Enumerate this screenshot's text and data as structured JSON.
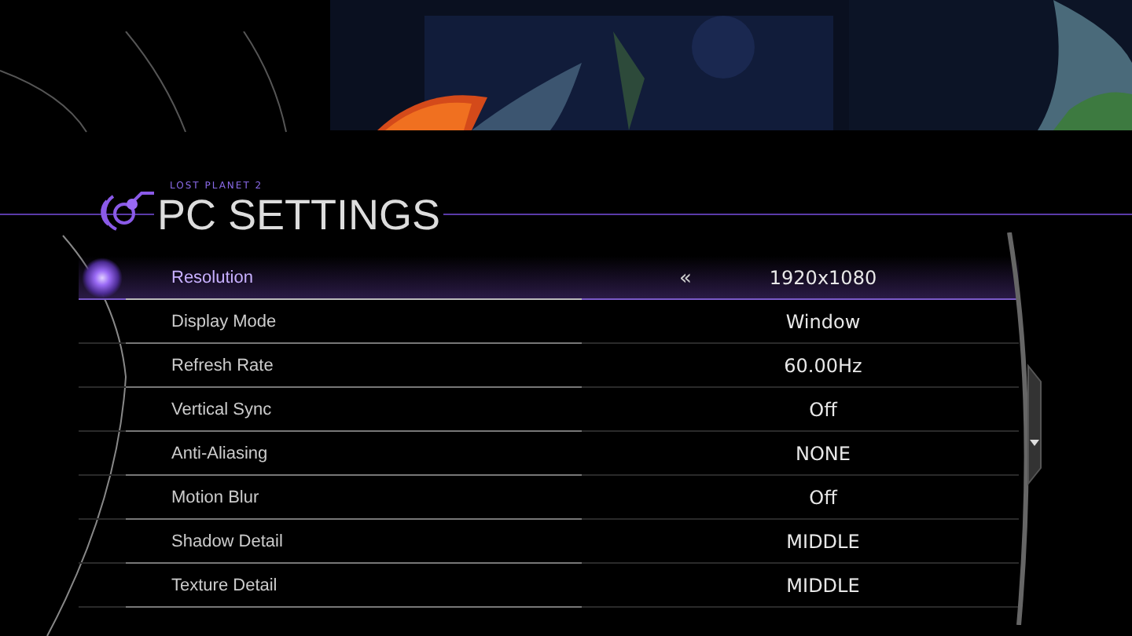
{
  "header": {
    "game": "LOST PLANET 2",
    "title": "PC SETTINGS"
  },
  "settings": [
    {
      "label": "Resolution",
      "value": "1920x1080",
      "selected": true
    },
    {
      "label": "Display Mode",
      "value": "Window",
      "selected": false
    },
    {
      "label": "Refresh Rate",
      "value": "60.00Hz",
      "selected": false
    },
    {
      "label": "Vertical Sync",
      "value": "Off",
      "selected": false
    },
    {
      "label": "Anti-Aliasing",
      "value": "NONE",
      "selected": false
    },
    {
      "label": "Motion Blur",
      "value": "Off",
      "selected": false
    },
    {
      "label": "Shadow Detail",
      "value": "MIDDLE",
      "selected": false
    },
    {
      "label": "Texture Detail",
      "value": "MIDDLE",
      "selected": false
    }
  ],
  "selected_arrow": "«"
}
